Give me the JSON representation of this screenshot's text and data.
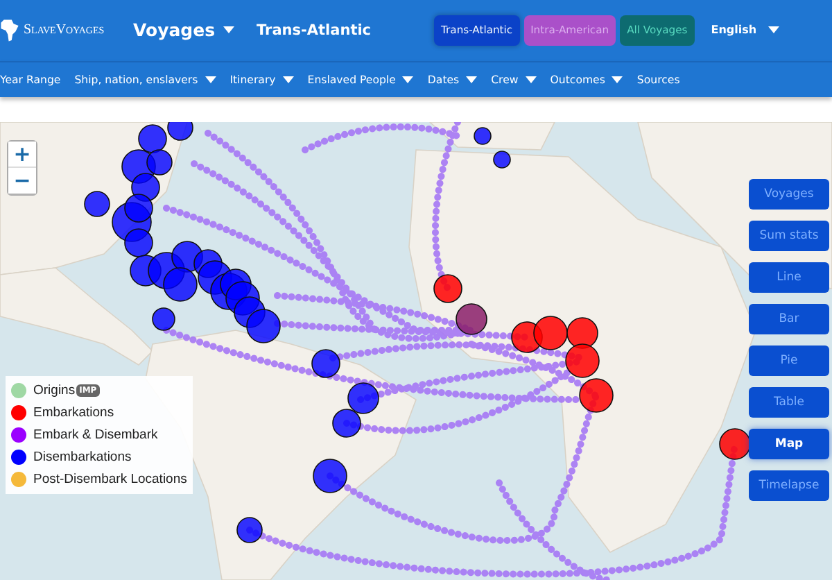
{
  "header": {
    "logo": "SlaveVoyages",
    "menu": {
      "label": "Voyages",
      "dropdown": true
    },
    "page_title": "Trans-Atlantic",
    "dataset_buttons": [
      {
        "label": "Trans-Atlantic",
        "selected": true,
        "color": "#0a40c8"
      },
      {
        "label": "Intra-American",
        "selected": false,
        "color": "#b24ec9"
      },
      {
        "label": "All Voyages",
        "selected": false,
        "color": "#0d6b6b"
      }
    ],
    "language": {
      "label": "English",
      "dropdown": true
    }
  },
  "filter_bar": {
    "items": [
      {
        "label": "Year Range",
        "dropdown": false
      },
      {
        "label": "Ship, nation, enslavers",
        "dropdown": true
      },
      {
        "label": "Itinerary",
        "dropdown": true
      },
      {
        "label": "Enslaved People",
        "dropdown": true
      },
      {
        "label": "Dates",
        "dropdown": true
      },
      {
        "label": "Crew",
        "dropdown": true
      },
      {
        "label": "Outcomes",
        "dropdown": true
      },
      {
        "label": "Sources",
        "dropdown": false
      }
    ]
  },
  "map": {
    "zoom_controls": [
      "+",
      "−"
    ],
    "legend": [
      {
        "label": "Origins",
        "badge": "IMP",
        "color": "#9fd8a4"
      },
      {
        "label": "Embarkations",
        "color": "#ff0000"
      },
      {
        "label": "Embark & Disembark",
        "color": "#9b00ff"
      },
      {
        "label": "Disembarkations",
        "color": "#0000ff"
      },
      {
        "label": "Post-Disembark Locations",
        "color": "#f5b93a"
      }
    ]
  },
  "view_buttons": [
    {
      "label": "Voyages",
      "selected": false
    },
    {
      "label": "Sum stats",
      "selected": false
    },
    {
      "label": "Line",
      "selected": false
    },
    {
      "label": "Bar",
      "selected": false
    },
    {
      "label": "Pie",
      "selected": false
    },
    {
      "label": "Table",
      "selected": false
    },
    {
      "label": "Map",
      "selected": true
    },
    {
      "label": "Timelapse",
      "selected": false
    }
  ]
}
